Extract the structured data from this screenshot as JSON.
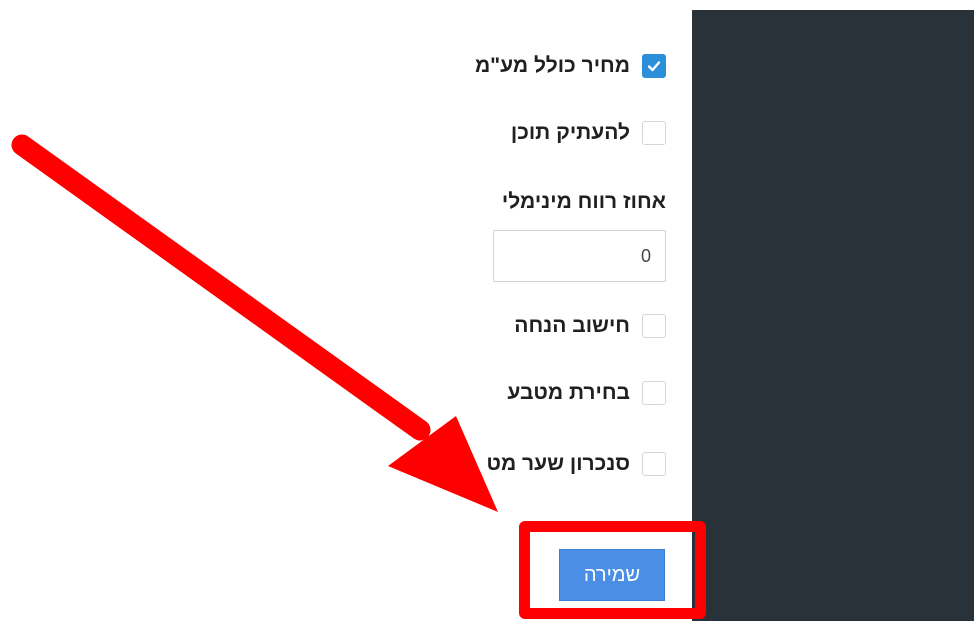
{
  "settings": {
    "vat_included": {
      "label": "מחיר כולל מע\"מ",
      "checked": true
    },
    "copy_content": {
      "label": "להעתיק תוכן",
      "checked": false
    },
    "min_profit": {
      "label": "אחוז רווח מינימלי",
      "value": "0"
    },
    "discount_calc": {
      "label": "חישוב הנחה",
      "checked": false
    },
    "currency_select": {
      "label": "בחירת מטבע",
      "checked": false
    },
    "rate_sync": {
      "label": "סנכרון שער מט",
      "checked": false
    }
  },
  "actions": {
    "save_label": "שמירה"
  },
  "colors": {
    "sidebar_bg": "#283238",
    "checkbox_checked": "#2b8fd9",
    "save_button_bg": "#4a8ee6",
    "annotation_red": "#ff0000"
  }
}
